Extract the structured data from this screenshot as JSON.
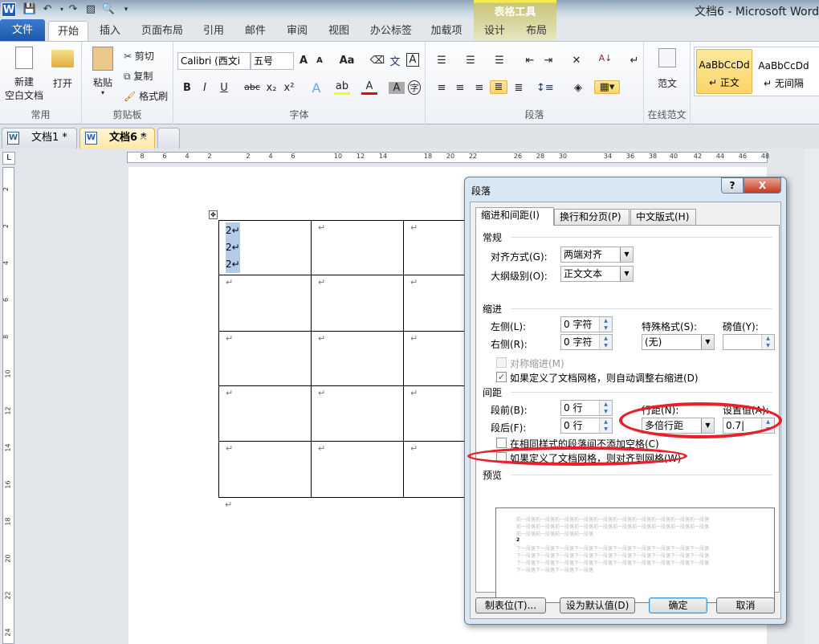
{
  "window": {
    "title": "文档6  -  Microsoft Word",
    "contextual_tab_group": "表格工具"
  },
  "quick_access": [
    "save-icon",
    "undo-icon",
    "redo-icon",
    "picture-icon",
    "print-preview-icon",
    "customize-icon"
  ],
  "ribbon_tabs": [
    "文件",
    "开始",
    "插入",
    "页面布局",
    "引用",
    "邮件",
    "审阅",
    "视图",
    "办公标签",
    "加载项",
    "设计",
    "布局"
  ],
  "ribbon": {
    "common": {
      "label": "常用",
      "new": "新建\n空白文档",
      "new1": "新建",
      "new2": "空白文档",
      "open": "打开"
    },
    "clipboard": {
      "label": "剪贴板",
      "paste": "粘贴",
      "cut": "剪切",
      "copy": "复制",
      "format_painter": "格式刷"
    },
    "font": {
      "label": "字体",
      "font_name": "Calibri (西文i",
      "font_size": "五号"
    },
    "paragraph": {
      "label": "段落"
    },
    "online": {
      "label": "在线范文",
      "sample": "范文"
    },
    "styles": [
      {
        "preview": "AaBbCcDd",
        "name": "正文"
      },
      {
        "preview": "AaBbCcDd",
        "name": "无间隔"
      }
    ]
  },
  "doc_tabs": [
    {
      "label": "文档1 *"
    },
    {
      "label": "文档6 *"
    }
  ],
  "ruler": {
    "h_ticks": [
      "8",
      "6",
      "4",
      "2",
      "2",
      "4",
      "6",
      "10",
      "12",
      "14",
      "18",
      "20",
      "22",
      "26",
      "28",
      "30",
      "34",
      "36",
      "38",
      "40",
      "42",
      "44",
      "46",
      "48"
    ],
    "v_ticks": [
      "2",
      "2",
      "4",
      "6",
      "8",
      "10",
      "12",
      "14",
      "16",
      "18",
      "20",
      "22",
      "24"
    ]
  },
  "document": {
    "cell_text": [
      "2",
      "2",
      "2"
    ],
    "mark": "↵"
  },
  "dialog": {
    "title": "段落",
    "help": "?",
    "close": "X",
    "tabs": [
      "缩进和间距(I)",
      "换行和分页(P)",
      "中文版式(H)"
    ],
    "general": {
      "heading": "常规",
      "alignment_label": "对齐方式(G):",
      "alignment_value": "两端对齐",
      "outline_label": "大纲级别(O):",
      "outline_value": "正文文本"
    },
    "indent": {
      "heading": "缩进",
      "left_label": "左侧(L):",
      "left_value": "0 字符",
      "right_label": "右侧(R):",
      "right_value": "0 字符",
      "special_label": "特殊格式(S):",
      "special_value": "(无)",
      "by_label": "磅值(Y):",
      "by_value": "",
      "mirror_label": "对称缩进(M)",
      "mirror_checked": false,
      "auto_adjust_label": "如果定义了文档网格，则自动调整右缩进(D)",
      "auto_adjust_checked": true
    },
    "spacing": {
      "heading": "间距",
      "before_label": "段前(B):",
      "before_value": "0 行",
      "after_label": "段后(F):",
      "after_value": "0 行",
      "line_label": "行距(N):",
      "line_value": "多倍行距",
      "at_label": "设置值(A):",
      "at_value": "0.7",
      "no_space_label": "在相同样式的段落间不添加空格(C)",
      "no_space_checked": false,
      "snap_grid_label": "如果定义了文档网格，则对齐到网格(W)",
      "snap_grid_checked": false
    },
    "preview": {
      "heading": "预览",
      "prev_text": "前一段落前一段落前一段落前一段落前一段落前一段落前一段落前一段落前一段落前一段落",
      "prev_short": "前一段落前一段落前一段落前一段落",
      "current": "2",
      "next_text": "下一段落下一段落下一段落下一段落下一段落下一段落下一段落下一段落下一段落下一段落",
      "next_short": "下一段落下一段落下一段落下一段落"
    },
    "buttons": {
      "tabs": "制表位(T)...",
      "default": "设为默认值(D)",
      "ok": "确定",
      "cancel": "取消"
    }
  },
  "colors": {
    "annotation": "#e8202a",
    "accent": "#1d57a8",
    "highlight": "#fbd669"
  }
}
